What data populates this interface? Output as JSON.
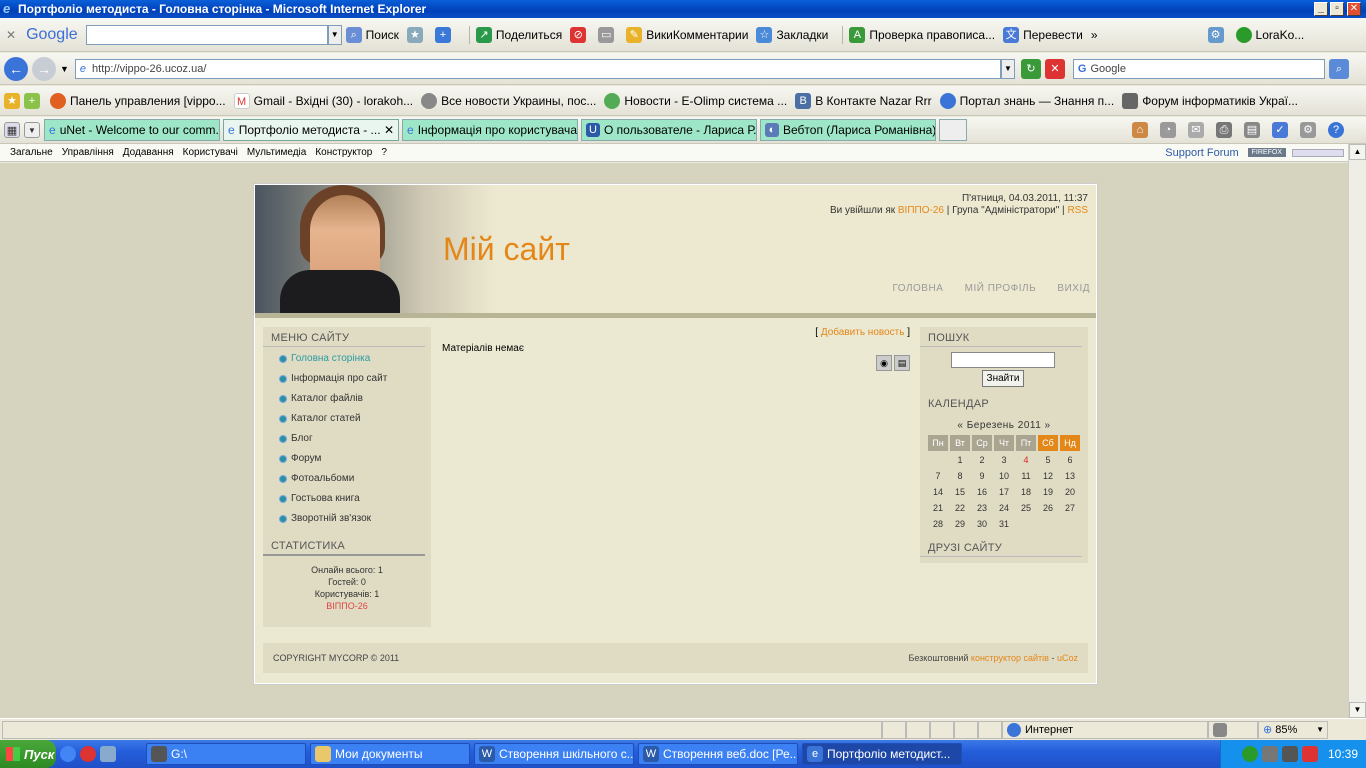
{
  "window": {
    "title": "Портфоліо методиста - Головна сторінка - Microsoft Internet Explorer"
  },
  "google_toolbar": {
    "logo": "Google",
    "search_label": "Поиск",
    "share_label": "Поделиться",
    "wiki_label": "ВикиКомментарии",
    "bookmarks_label": "Закладки",
    "spell_label": "Проверка правописа...",
    "translate_label": "Перевести",
    "user_label": "LoraKo..."
  },
  "address_bar": {
    "url": "http://vippo-26.ucoz.ua/",
    "search_placeholder": "Google"
  },
  "favorites": [
    "Панель управления [vippo...",
    "Gmail - Вхідні (30) - lorakoh...",
    "Все новости Украины, пос...",
    "Новости - E-Olimp система ...",
    "В Контакте  Nazar Rrr",
    "Портал знань — Знання п...",
    "Форум інформатиків Украї..."
  ],
  "tabs": [
    "uNet - Welcome to our comm...",
    "Портфоліо методиста - ...",
    "Інформація про користувача",
    "О пользователе - Лариса Р...",
    "Вебтоп (Лариса Романівна)"
  ],
  "ucoz_bar": {
    "items": [
      "Загальне",
      "Управління",
      "Додавання",
      "Користувачі",
      "Мультимедіа",
      "Конструктор",
      "?"
    ],
    "support": "Support Forum",
    "firefox_badge": "FIREFOX"
  },
  "site": {
    "title": "Мій сайт",
    "datetime": "П'ятниця, 04.03.2011, 11:37",
    "login_prefix": "Ви увійшли як",
    "login_user": "ВІППО-26",
    "login_group": "| Група \"Адміністратори\" |",
    "rss": "RSS",
    "nav": [
      "ГОЛОВНА",
      "МІЙ ПРОФІЛЬ",
      "ВИХІД"
    ],
    "menu_title": "МЕНЮ САЙТУ",
    "menu": [
      "Головна сторінка",
      "Інформація про сайт",
      "Каталог файлів",
      "Каталог статей",
      "Блог",
      "Форум",
      "Фотоальбоми",
      "Гостьова книга",
      "Зворотній зв'язок"
    ],
    "stats_title": "СТАТИСТИКА",
    "stats_online": "Онлайн всього: 1",
    "stats_guests": "Гостей: 0",
    "stats_users": "Користувачів: 1",
    "stats_user": "ВІППО-26",
    "add_news_open": "[",
    "add_news": "Добавить новость",
    "add_news_close": "]",
    "no_materials": "Матеріалів немає",
    "search_title": "ПОШУК",
    "search_button": "Знайти",
    "calendar_title": "КАЛЕНДАР",
    "calendar_month": "«  Березень 2011  »",
    "weekdays": [
      "Пн",
      "Вт",
      "Ср",
      "Чт",
      "Пт",
      "Сб",
      "Нд"
    ],
    "calendar_weeks": [
      [
        "",
        "1",
        "2",
        "3",
        "4",
        "5",
        "6"
      ],
      [
        "7",
        "8",
        "9",
        "10",
        "11",
        "12",
        "13"
      ],
      [
        "14",
        "15",
        "16",
        "17",
        "18",
        "19",
        "20"
      ],
      [
        "21",
        "22",
        "23",
        "24",
        "25",
        "26",
        "27"
      ],
      [
        "28",
        "29",
        "30",
        "31",
        "",
        "",
        ""
      ]
    ],
    "friends_title": "ДРУЗІ САЙТУ",
    "copyright": "COPYRIGHT MYCORP © 2011",
    "footer_free": "Безкоштовний",
    "footer_constructor": "конструктор сайтів",
    "footer_dash": "-",
    "footer_ucoz": "uCoz"
  },
  "status_bar": {
    "zone": "Интернет",
    "zoom": "85%"
  },
  "taskbar": {
    "start": "Пуск",
    "tasks": [
      "G:\\",
      "Мои документы",
      "Створення шкільного с...",
      "Створення веб.doc [Ре...",
      "Портфоліо методист..."
    ],
    "lang": "EN",
    "clock": "10:39"
  }
}
